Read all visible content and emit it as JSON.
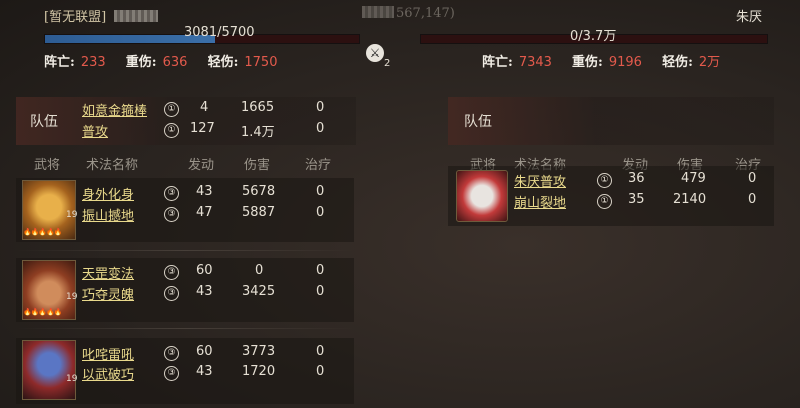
{
  "header": {
    "left_alliance": "[暂无联盟]",
    "left_coords": "567,147)",
    "right_name": "朱厌"
  },
  "left_troops": {
    "text": "3081/5700",
    "fraction": 0.54,
    "color": "#3b6fa8"
  },
  "right_troops": {
    "text": "0/3.7万",
    "fraction": 0.0,
    "color": "#a02828"
  },
  "casualties": {
    "labels": [
      "阵亡:",
      "重伤:",
      "轻伤:"
    ],
    "left": [
      "233",
      "636",
      "1750"
    ],
    "right": [
      "7343",
      "9196",
      "2万"
    ]
  },
  "center_badge": {
    "icon": "swords-icon",
    "count": "2"
  },
  "team_label": "队伍",
  "columns": [
    "武将",
    "术法名称",
    "发动",
    "伤害",
    "治疗"
  ],
  "left_team_rows": [
    {
      "name": "如意金箍棒",
      "level": "①",
      "casts": "4",
      "damage": "1665",
      "heal": "0"
    },
    {
      "name": "普攻",
      "level": "①",
      "casts": "127",
      "damage": "1.4万",
      "heal": "0"
    }
  ],
  "heroes": [
    {
      "icon": "monkey-king-portrait",
      "lvl": "19",
      "skills": [
        {
          "name": "身外化身",
          "level": "③",
          "casts": "43",
          "damage": "5678",
          "heal": "0"
        },
        {
          "name": "振山撼地",
          "level": "③",
          "casts": "47",
          "damage": "5887",
          "heal": "0"
        }
      ]
    },
    {
      "icon": "pig-warrior-portrait",
      "lvl": "19",
      "skills": [
        {
          "name": "天罡变法",
          "level": "③",
          "casts": "60",
          "damage": "0",
          "heal": "0"
        },
        {
          "name": "巧夺灵魄",
          "level": "③",
          "casts": "43",
          "damage": "3425",
          "heal": "0"
        }
      ]
    },
    {
      "icon": "blue-demon-portrait",
      "lvl": "19",
      "skills": [
        {
          "name": "叱咤雷吼",
          "level": "③",
          "casts": "60",
          "damage": "3773",
          "heal": "0"
        },
        {
          "name": "以武破巧",
          "level": "③",
          "casts": "43",
          "damage": "1720",
          "heal": "0"
        }
      ]
    }
  ],
  "enemy": {
    "icon": "white-ape-portrait",
    "skills": [
      {
        "name": "朱厌普攻",
        "level": "①",
        "casts": "36",
        "damage": "479",
        "heal": "0"
      },
      {
        "name": "崩山裂地",
        "level": "①",
        "casts": "35",
        "damage": "2140",
        "heal": "0"
      }
    ]
  },
  "colors": {
    "skill_text": "#e9d98c",
    "casualty_value": "#e35a4c",
    "star": "#e8a63a"
  }
}
